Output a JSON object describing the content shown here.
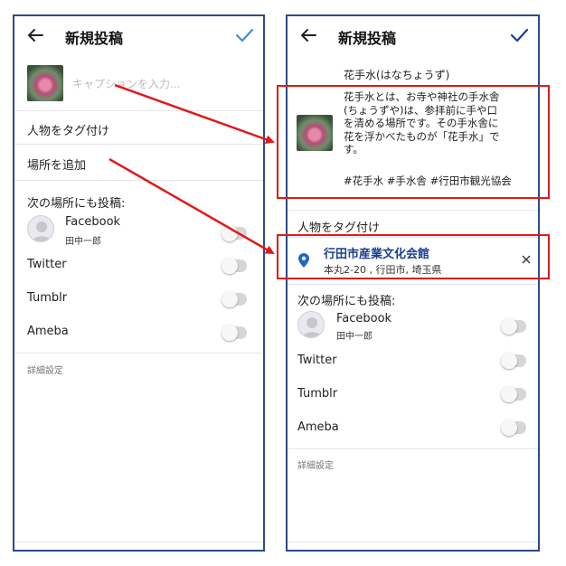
{
  "colors": {
    "frame": "#2f4a8a",
    "accent": "#1f66c7",
    "callout": "#e01919",
    "link": "#1a3f8f"
  },
  "left_screen": {
    "header": {
      "title": "新規投稿",
      "back_icon": "back-arrow-icon",
      "confirm_icon": "check-icon"
    },
    "caption_placeholder": "キャプションを入力...",
    "tag_people": "人物をタグ付け",
    "add_location": "場所を追加",
    "share_also_heading": "次の場所にも投稿:",
    "share_targets": [
      {
        "name": "Facebook",
        "account": "田中一郎"
      },
      {
        "name": "Twitter"
      },
      {
        "name": "Tumblr"
      },
      {
        "name": "Ameba"
      }
    ],
    "advanced_settings": "詳細設定"
  },
  "right_screen": {
    "header": {
      "title": "新規投稿",
      "back_icon": "back-arrow-icon",
      "confirm_icon": "check-icon"
    },
    "caption_title": "花手水(はなちょうず)",
    "caption_lines": [
      "花手水とは、お寺や神社の手水舎",
      "(ちょうずや)は、参拝前に手や口",
      "を清める場所です。その手水舎に",
      "花を浮かべたものが「花手水」で",
      "す。"
    ],
    "hashtags": "#花手水 #手水舎 #行田市観光協会",
    "tag_people": "人物をタグ付け",
    "location": {
      "name": "行田市産業文化会館",
      "address": "本丸2-20 , 行田市, 埼玉県",
      "clear_icon": "close-icon",
      "pin_icon": "location-pin-icon"
    },
    "share_also_heading": "次の場所にも投稿:",
    "share_targets": [
      {
        "name": "Facebook",
        "account": "田中一郎"
      },
      {
        "name": "Twitter"
      },
      {
        "name": "Tumblr"
      },
      {
        "name": "Ameba"
      }
    ],
    "advanced_settings": "詳細設定"
  }
}
